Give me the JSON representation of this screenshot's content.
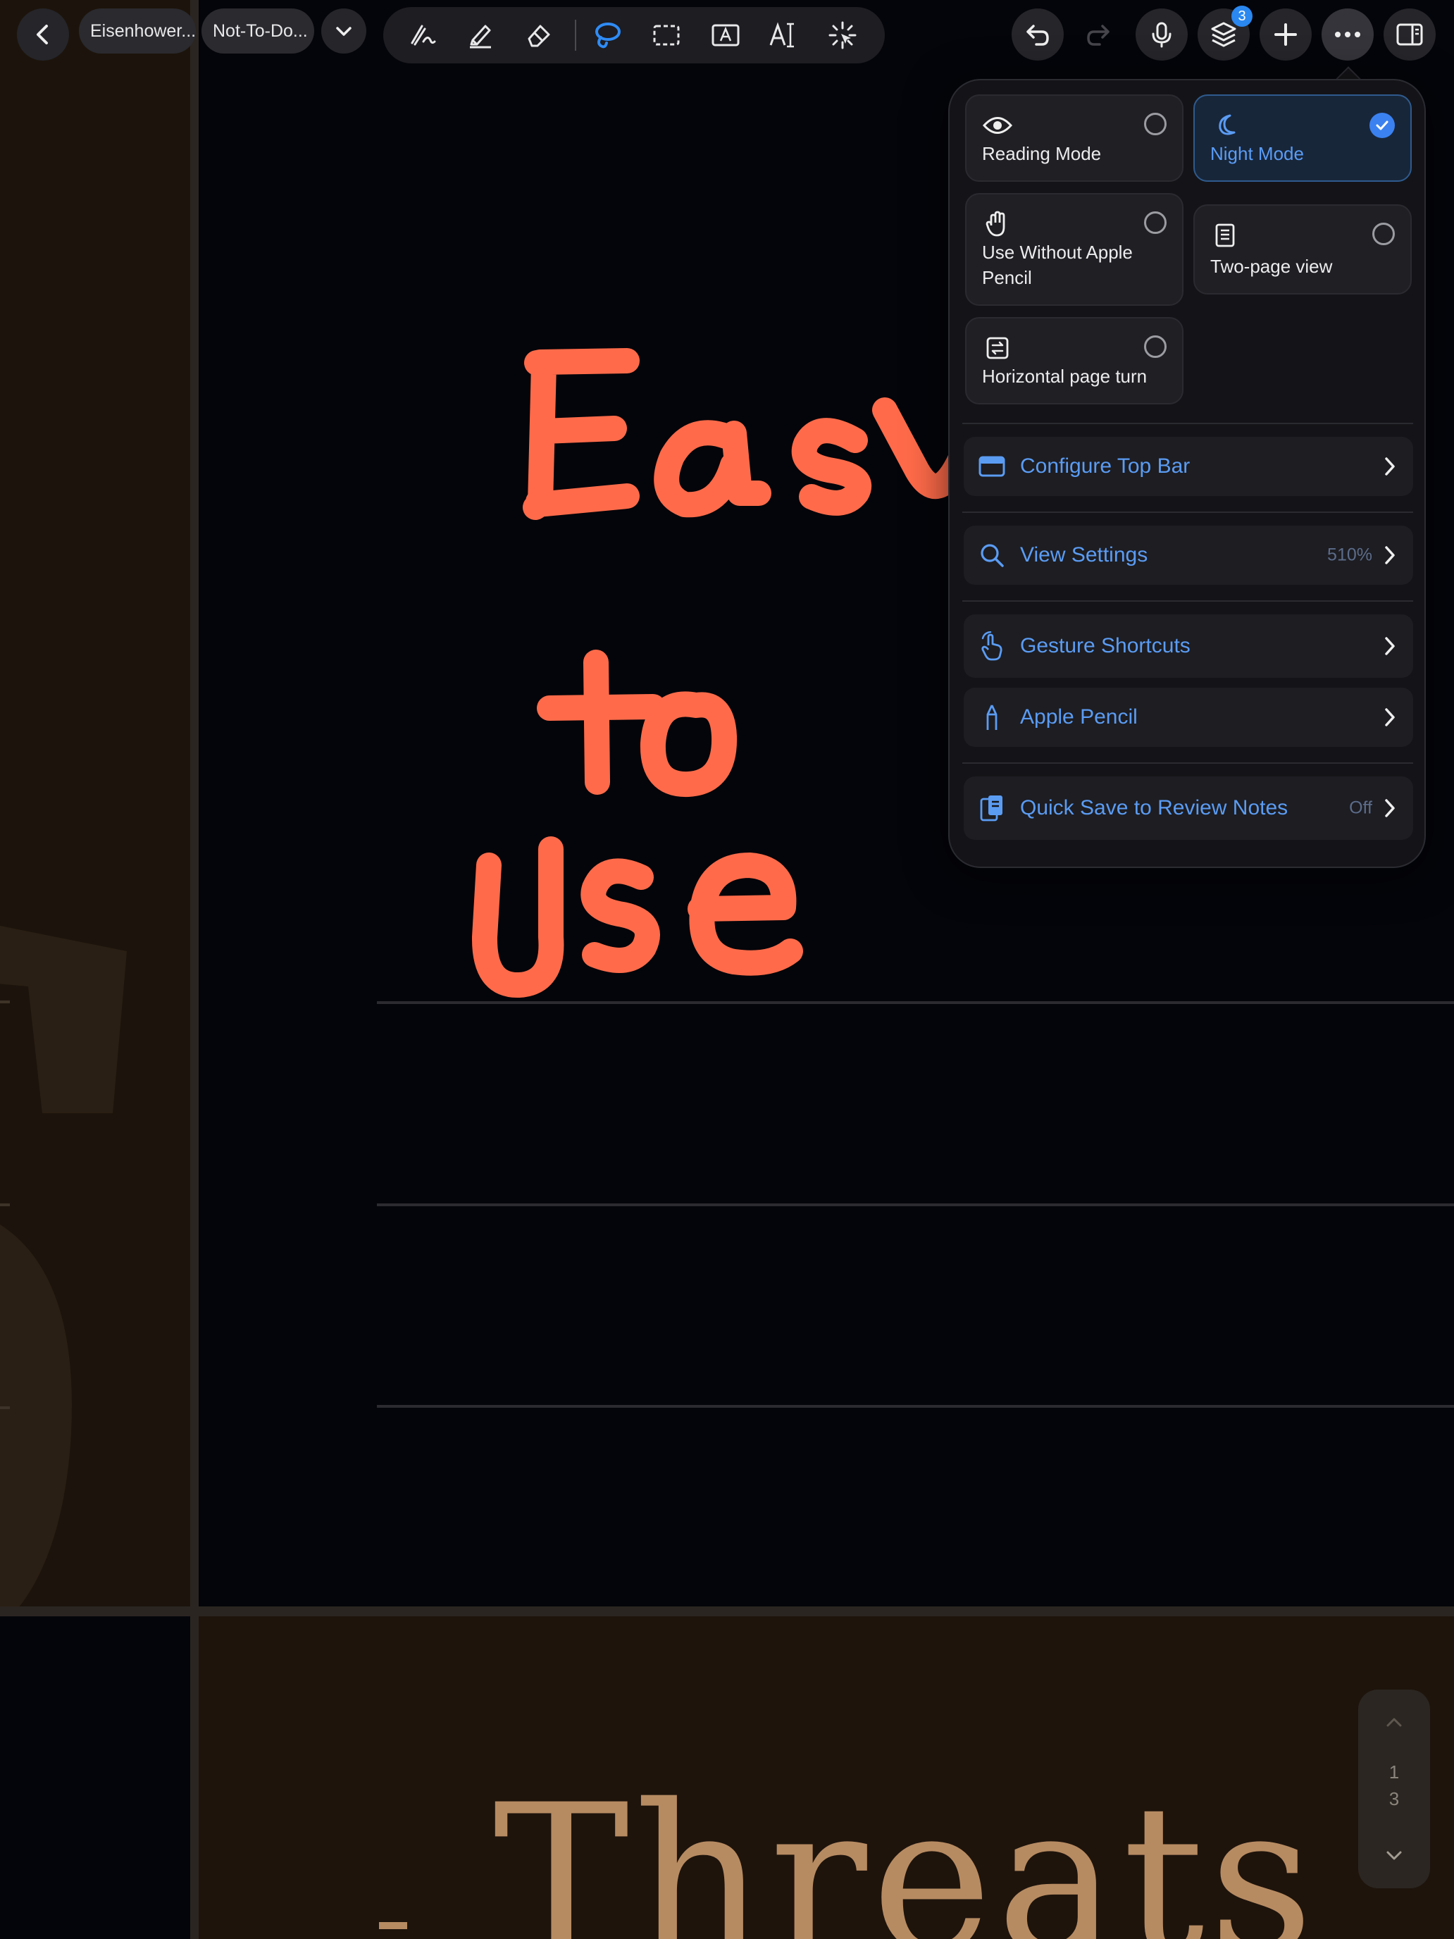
{
  "tabs": [
    {
      "label": "Eisenhower..."
    },
    {
      "label": "Not-To-Do..."
    }
  ],
  "toolbar": {
    "tools": [
      "pen-icon",
      "highlighter-icon",
      "eraser-icon",
      "lasso-icon",
      "selection-icon",
      "textbox-icon",
      "text-icon",
      "laser-pointer-icon"
    ],
    "active_tool": "lasso-icon",
    "layers_badge": "3"
  },
  "canvas": {
    "handwriting": [
      "Easy",
      "to",
      "Use"
    ],
    "ink_color": "#ff6b4a",
    "next_page_heading": "Threats",
    "heading_color": "#b78b62"
  },
  "menu": {
    "modes": [
      {
        "label": "Reading Mode",
        "icon": "eye-icon",
        "checked": false
      },
      {
        "label": "Night Mode",
        "icon": "moon-icon",
        "checked": true
      },
      {
        "label": "Use Without Apple Pencil",
        "icon": "hand-icon",
        "checked": false
      },
      {
        "label": "Two-page view",
        "icon": "pages-icon",
        "checked": false
      },
      {
        "label": "Horizontal page turn",
        "icon": "page-turn-icon",
        "checked": false
      }
    ],
    "rows": [
      {
        "label": "Configure Top Bar",
        "icon": "top-bar-icon",
        "value": ""
      },
      {
        "label": "View Settings",
        "icon": "magnifier-icon",
        "value": "510%"
      },
      {
        "label": "Gesture Shortcuts",
        "icon": "gesture-icon",
        "value": ""
      },
      {
        "label": "Apple Pencil",
        "icon": "pencil-icon",
        "value": ""
      },
      {
        "label": "Quick Save to Review Notes",
        "icon": "clipboard-icon",
        "value": "Off"
      }
    ],
    "accent": "#5b9cf3"
  },
  "pager": {
    "current": "1",
    "total": "3"
  }
}
